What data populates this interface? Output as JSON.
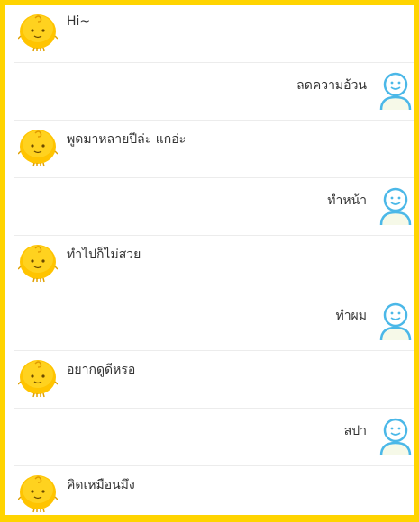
{
  "messages": [
    {
      "sender": "bot",
      "text": "Hi~"
    },
    {
      "sender": "user",
      "text": "ลดความอ้วน"
    },
    {
      "sender": "bot",
      "text": "พูดมาหลายปีล่ะ แกอ่ะ"
    },
    {
      "sender": "user",
      "text": "ทำหน้า"
    },
    {
      "sender": "bot",
      "text": "ทำไปก็ไม่สวย"
    },
    {
      "sender": "user",
      "text": "ทำผม"
    },
    {
      "sender": "bot",
      "text": "อยากดูดีหรอ"
    },
    {
      "sender": "user",
      "text": "สปา"
    },
    {
      "sender": "bot",
      "text": "คิดเหมือนมึง"
    }
  ],
  "icons": {
    "bot_avatar": "yellow-chick-icon",
    "user_avatar": "blue-person-icon"
  },
  "colors": {
    "frame": "#FFD400",
    "bot_avatar": "#FFC400",
    "user_avatar": "#4BB8E8",
    "text": "#333333",
    "divider": "#ECECEC"
  }
}
